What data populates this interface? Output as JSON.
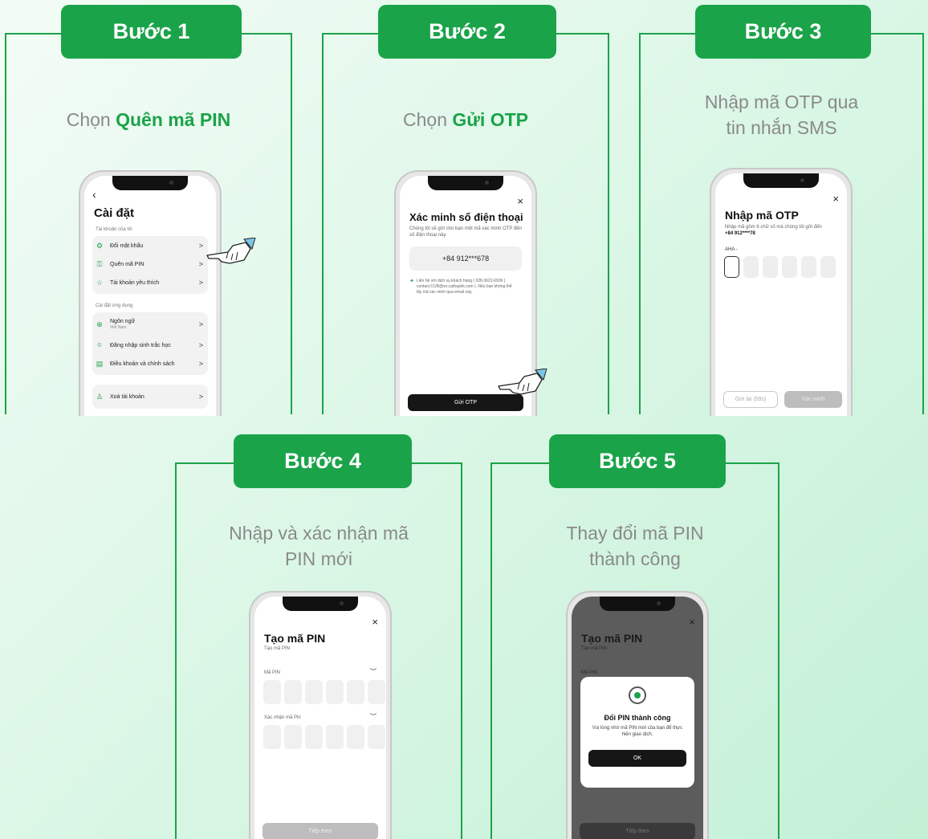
{
  "steps": [
    {
      "badge": "Bước 1",
      "caption_prefix": "Chọn ",
      "caption_bold": "Quên mã PIN"
    },
    {
      "badge": "Bước 2",
      "caption_prefix": "Chọn ",
      "caption_bold": "Gửi OTP"
    },
    {
      "badge": "Bước 3",
      "caption_line1": "Nhập mã OTP qua",
      "caption_line2": "tin nhắn SMS"
    },
    {
      "badge": "Bước 4",
      "caption_line1": "Nhập và xác nhận mã",
      "caption_line2": "PIN mới"
    },
    {
      "badge": "Bước 5",
      "caption_line1": "Thay đổi mã PIN",
      "caption_line2": "thành công"
    }
  ],
  "screen1": {
    "back": "‹",
    "title": "Cài đặt",
    "section1": "Tài khoản của tôi",
    "items1": [
      {
        "icon": "gear-icon",
        "label": "Đổi mật khẩu"
      },
      {
        "icon": "key-icon",
        "label": "Quên mã PIN"
      },
      {
        "icon": "star-icon",
        "label": "Tài khoản yêu thích"
      }
    ],
    "section2": "Cài đặt ứng dụng",
    "items2": [
      {
        "icon": "globe-icon",
        "label": "Ngôn ngữ",
        "sub": "Việt Nam"
      },
      {
        "icon": "face-id-icon",
        "label": "Đăng nhập sinh trắc học"
      },
      {
        "icon": "document-icon",
        "label": "Điều khoản và chính sách"
      }
    ],
    "delete_label": "Xoá tài khoản",
    "chevron": ">"
  },
  "screen2": {
    "close": "×",
    "title": "Xác minh số điện thoại",
    "desc": "Chúng tôi sẽ gửi cho bạn một mã xác minh OTP đến số điện thoại này.",
    "phone": "+84 912***678",
    "contact": "Liên hệ với dịch vụ khách hàng ( 028-3622-6936 ) contact.CUB@vn.cathaybk.com ). Nếu bạn không thể lấy mã xác minh qua email này.",
    "button": "Gửi OTP"
  },
  "screen3": {
    "close": "×",
    "title": "Nhập mã OTP",
    "desc": "Nhập mã gồm 6 chữ số mà chúng tôi gửi đến",
    "phone": "+84 912****78",
    "prefix": "AHA -",
    "resend": "Gửi lại (59s)",
    "verify": "Xác minh"
  },
  "screen4": {
    "close": "×",
    "title": "Tạo mã PIN",
    "subtitle": "Tạo mã PIN",
    "label1": "Mã PIN",
    "label2": "Xác nhận mã Pin",
    "button": "Tiếp theo"
  },
  "screen5": {
    "close": "×",
    "title": "Tạo mã PIN",
    "subtitle": "Tạo mã PIN",
    "label1": "Mã PIN",
    "dialog_title": "Đổi PIN thành công",
    "dialog_text": "Vui lòng nhớ mã PIN mới của bạn để thực hiện giao dịch.",
    "dialog_button": "OK",
    "button": "Tiếp theo"
  },
  "colors": {
    "brand": "#1ba34a",
    "caption": "#8a8a8a",
    "dark_button": "#161616"
  }
}
